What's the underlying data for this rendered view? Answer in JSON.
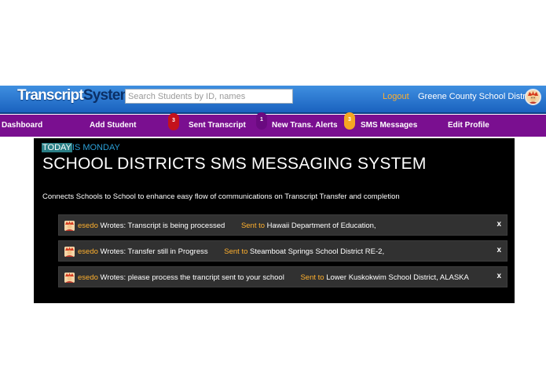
{
  "header": {
    "logo_part1": "Transcript",
    "logo_part2": "System",
    "search_placeholder": "Search Students by ID, names",
    "logout_label": "Logout",
    "district_name": "Greene County School District"
  },
  "nav": {
    "items": [
      {
        "label": "Dashboard"
      },
      {
        "label": "Add Student"
      },
      {
        "label": "Sent Transcript",
        "badge": "3"
      },
      {
        "label": "New Trans. Alerts",
        "badge": "1"
      },
      {
        "label": "SMS Messages",
        "badge": "3"
      },
      {
        "label": "Edit Profile"
      }
    ],
    "badge_colors": {
      "sent": "#c4121c",
      "alerts": "#6a0a80",
      "sms": "#f5a623"
    }
  },
  "main": {
    "today_label": "TODAY",
    "day_text": "IS MONDAY",
    "title": "SCHOOL DISTRICTS SMS MESSAGING SYSTEM",
    "description": "Connects Schools to School to enhance easy flow of communications on Transcript Transfer and completion",
    "messages": [
      {
        "user": "esedo",
        "text": " Wrotes: Transcript is being processed",
        "sent_label": "Sent to",
        "recipient": " Hawaii Department of Education,",
        "close": "x"
      },
      {
        "user": "esedo",
        "text": " Wrotes: Transfer still in Progress",
        "sent_label": "Sent to",
        "recipient": " Steamboat Springs School District RE-2,",
        "close": "x"
      },
      {
        "user": "esedo",
        "text": " Wrotes: please process the trancript sent to your school",
        "sent_label": "Sent to",
        "recipient": " Lower Kuskokwim School District, ALASKA",
        "close": "x"
      }
    ]
  },
  "colors": {
    "accent_orange": "#ffb02e",
    "nav_purple": "#7a0f90",
    "header_blue": "#1a62bf"
  },
  "icons": [
    "avatar-icon",
    "close-icon"
  ]
}
